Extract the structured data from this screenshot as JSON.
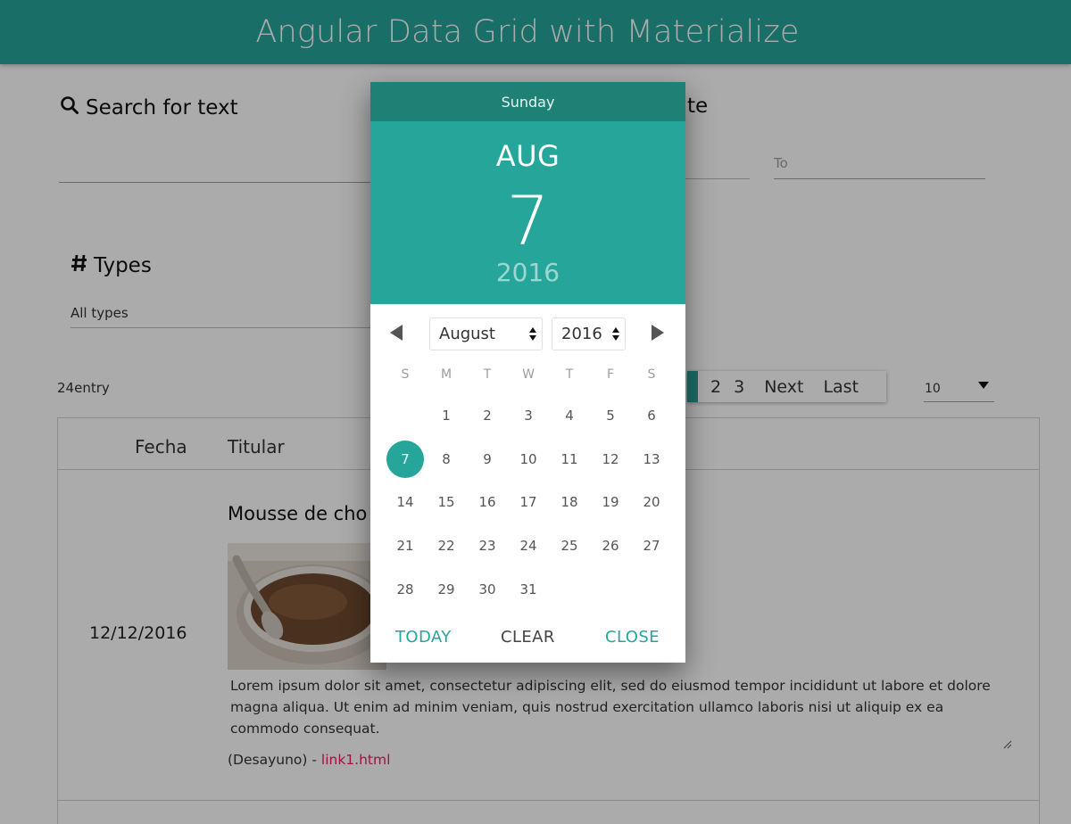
{
  "header": {
    "title": "Angular Data Grid with Materialize"
  },
  "search": {
    "label": "Search for text"
  },
  "date_filter": {
    "label_fragment": "te",
    "to_placeholder": "To"
  },
  "types": {
    "label": "Types",
    "selected": "All types"
  },
  "entry_count": "24entry",
  "pagination": {
    "pages": [
      "2",
      "3"
    ],
    "next": "Next",
    "last": "Last",
    "page_size": "10"
  },
  "table": {
    "columns": [
      "Fecha",
      "Titular"
    ],
    "rows": [
      {
        "fecha": "12/12/2016",
        "titular": "Mousse de cho",
        "description": "Lorem ipsum dolor sit amet, consectetur adipiscing elit, sed do eiusmod tempor incididunt ut labore et dolore magna aliqua. Ut enim ad minim veniam, quis nostrud exercitation ullamco laboris nisi ut aliquip ex ea commodo consequat.",
        "category": "(Desayuno) - ",
        "link": "link1.html"
      }
    ]
  },
  "datepicker": {
    "weekday": "Sunday",
    "month_short": "AUG",
    "day": "7",
    "year": "2016",
    "month_select": "August",
    "year_select": "2016",
    "weekday_initials": [
      "S",
      "M",
      "T",
      "W",
      "T",
      "F",
      "S"
    ],
    "first_weekday_offset": 1,
    "days_in_month": 31,
    "selected_day": 7,
    "today_label": "TODAY",
    "clear_label": "CLEAR",
    "close_label": "CLOSE"
  },
  "colors": {
    "accent": "#26a69a",
    "accent_dark": "#1f8076",
    "link": "#e91e63"
  },
  "icons": {
    "search": "search-icon",
    "types": "hash-icon"
  }
}
